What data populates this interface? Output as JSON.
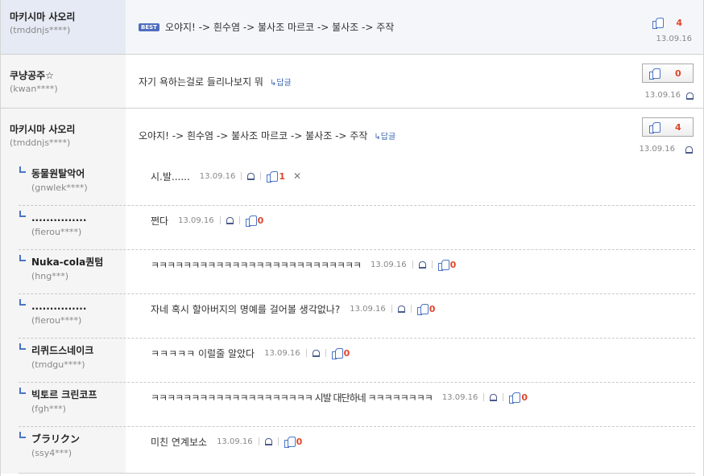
{
  "best_comment": {
    "badge": "BEST",
    "author": "마키시마 사오리",
    "user_id": "(tmddnjs****)",
    "text": "오야지! -> 흰수염 -> 불사조 마르코 -> 불사조 -> 주작",
    "likes": "4",
    "date": "13.09.16"
  },
  "comments": [
    {
      "author": "쿠냥공주☆",
      "user_id": "(kwan****)",
      "text": "자기 욕하는걸로 들리나보지 뭐",
      "reply_label": "↳답글",
      "likes": "0",
      "date": "13.09.16"
    },
    {
      "author": "마키시마 사오리",
      "user_id": "(tmddnjs****)",
      "text": "오야지! -> 흰수염 -> 불사조 마르코 -> 불사조 -> 주작",
      "reply_label": "↳답글",
      "likes": "4",
      "date": "13.09.16"
    }
  ],
  "replies": [
    {
      "author": "동물원탈악어",
      "user_id": "(gnwlek****)",
      "text": "시.발......",
      "date": "13.09.16",
      "likes": "1",
      "deletable": true,
      "delete_label": "✕"
    },
    {
      "author": "...............",
      "user_id": "(fierou****)",
      "text": "쩐다",
      "date": "13.09.16",
      "likes": "0"
    },
    {
      "author": "Nuka-cola퀀텀",
      "user_id": "(hng***)",
      "text": "ㅋㅋㅋㅋㅋㅋㅋㅋㅋㅋㅋㅋㅋㅋㅋㅋㅋㅋㅋㅋㅋㅋㅋㅋㅋㅋ",
      "date": "13.09.16",
      "likes": "0"
    },
    {
      "author": "...............",
      "user_id": "(fierou****)",
      "text": "자네 혹시 할아버지의 명예를 걸어볼 생각없나?",
      "date": "13.09.16",
      "likes": "0"
    },
    {
      "author": "리퀴드스네이크",
      "user_id": "(tmdgu****)",
      "text": "ㅋㅋㅋㅋㅋ 이럴줄 알았다",
      "date": "13.09.16",
      "likes": "0"
    },
    {
      "author": "빅토르 크린코프",
      "user_id": "(fgh***)",
      "text": "ㅋㅋㅋㅋㅋㅋㅋㅋㅋㅋㅋㅋㅋㅋㅋㅋㅋㅋㅋㅋ 시발 대단하네 ㅋㅋㅋㅋㅋㅋㅋㅋ",
      "date": "13.09.16",
      "likes": "0"
    },
    {
      "author": "ブラリクン",
      "user_id": "(ssy4***)",
      "text": "미친 연계보소",
      "date": "13.09.16",
      "likes": "0"
    }
  ],
  "colors": {
    "accent": "#4a74c6",
    "like_count": "#e0452a",
    "best_bg": "#e6eaf4"
  }
}
